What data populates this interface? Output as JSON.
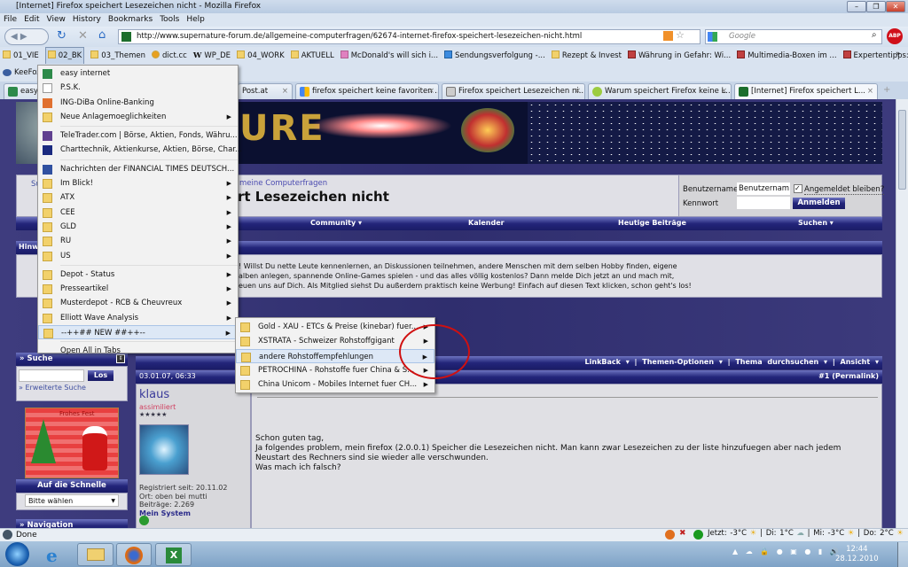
{
  "window": {
    "title": "[Internet] Firefox speichert Lesezeichen nicht - Mozilla Firefox"
  },
  "menu": [
    "File",
    "Edit",
    "View",
    "History",
    "Bookmarks",
    "Tools",
    "Help"
  ],
  "nav": {
    "url": "http://www.supernature-forum.de/allgemeine-computerfragen/62674-internet-firefox-speichert-lesezeichen-nicht.html",
    "search_placeholder": "Google"
  },
  "bookmarks_bar": [
    "01_VIE",
    "02_BK",
    "03_Themen",
    "dict.cc",
    "WP_DE",
    "04_WORK",
    "AKTUELL",
    "McDonald's will sich i...",
    "Sendungsverfolgung -...",
    "Rezept & Invest",
    "Währung in Gefahr: Wi...",
    "Multimedia-Boxen im ...",
    "Expertentipps: So gelin..."
  ],
  "keefox": "KeeFox",
  "tabs": [
    "easy i",
    "Post.at",
    "firefox speichert keine favoriten ...",
    "Firefox speichert Lesezeichen ni...",
    "Warum speichert Firefox keine L...",
    "[Internet] Firefox speichert L..."
  ],
  "bm_menu": [
    {
      "label": "easy internet",
      "sub": false
    },
    {
      "label": "P.S.K.",
      "sub": false
    },
    {
      "label": "ING-DiBa Online-Banking",
      "sub": false
    },
    {
      "label": "Neue Anlagemoeglichkeiten",
      "sub": true
    },
    {
      "label": "TeleTrader.com | Börse, Aktien, Fonds, Währu...",
      "sub": false
    },
    {
      "label": "Charttechnik, Aktienkurse, Aktien, Börse, Char...",
      "sub": false
    },
    {
      "label": "Nachrichten der FINANCIAL TIMES DEUTSCH...",
      "sub": false
    },
    {
      "label": "Im Blick!",
      "sub": true
    },
    {
      "label": "ATX",
      "sub": true
    },
    {
      "label": "CEE",
      "sub": true
    },
    {
      "label": "GLD",
      "sub": true
    },
    {
      "label": "RU",
      "sub": true
    },
    {
      "label": "US",
      "sub": true
    },
    {
      "label": "Depot - Status",
      "sub": true
    },
    {
      "label": "Presseartikel",
      "sub": true
    },
    {
      "label": "Musterdepot - RCB & Cheuvreux",
      "sub": true
    },
    {
      "label": "Elliott Wave Analysis",
      "sub": true
    },
    {
      "label": "--++## NEW ##++--",
      "sub": true
    },
    {
      "label": "Open All in Tabs",
      "sub": false
    }
  ],
  "sub_menu": [
    "Gold - XAU - ETCs & Preise (kinebar) fuer...",
    "XSTRATA - Schweizer Rohstoffgigant",
    "andere Rohstoffempfehlungen",
    "PETROCHINA - Rohstoffe fuer China & S...",
    "China Unicom - Mobiles Internet fuer CH..."
  ],
  "page": {
    "breadcrumb": "meine Computerfragen",
    "title": "rt Lesezeichen nicht",
    "sidebar_short": "Su",
    "login": {
      "user_label": "Benutzername",
      "user_value": "Benutzernam",
      "remember": "Angemeldet bleiben?",
      "pass_label": "Kennwort",
      "submit": "Anmelden"
    },
    "navlinks": [
      "Community ▾",
      "Kalender",
      "Heutige Beiträge",
      "Suchen ▾"
    ],
    "notice_title": "Hinw",
    "notice": [
      "! Willst Du nette Leute kennenlernen, an Diskussionen teilnehmen, andere Menschen mit dem selben Hobby finden, eigene",
      "alben anlegen, spannende Online-Games spielen - und das alles völlig kostenlos? Dann melde Dich jetzt an und mach mit,",
      "euen uns auf Dich. Als Mitglied siehst Du außerdem praktisch keine Werbung! Einfach auf diesen Text klicken, schon geht's los!"
    ],
    "thread_tools": [
      "LinkBack ▾",
      "Themen-Optionen ▾",
      "Thema durchsuchen ▾",
      "Ansicht ▾"
    ],
    "post": {
      "date": "03.01.07, 06:33",
      "permalink": "#1 (Permalink)",
      "user": "klaus",
      "rank": "assimiliert",
      "stars": "★★★★★",
      "registered": "Registriert seit: 20.11.02",
      "location": "Ort: oben bei mutti",
      "posts": "Beiträge: 2.269",
      "system": "Mein System",
      "body": [
        "Schon guten tag,",
        "Ja folgendes problem, mein firefox (2.0.0.1) Speicher die Lesezeichen nicht. Man kann zwar Lesezeichen zu der liste hinzufuegen aber nach jedem",
        "Neustart des Rechners sind sie wieder alle verschwunden.",
        "Was mach ich falsch?"
      ]
    },
    "search_title": "» Suche",
    "search_go": "Los",
    "adv_search": "» Erweiterte Suche",
    "xmas": "Frohes Fest",
    "quick_title": "Auf die Schnelle",
    "quick_select": "Bitte wählen",
    "nav_title": "» Navigation"
  },
  "status": {
    "text": "Done",
    "weather": [
      "Jetzt: -3°C",
      "Di: 1°C",
      "Mi: -3°C",
      "Do: 2°C"
    ]
  },
  "clock": {
    "time": "12:44",
    "date": "28.12.2010"
  },
  "colors": {
    "accent": "#23257a",
    "annotation": "#d01010"
  }
}
